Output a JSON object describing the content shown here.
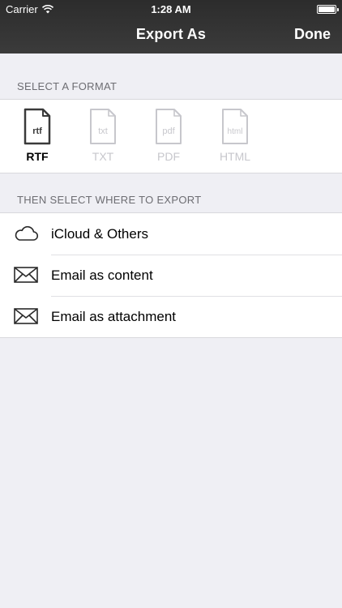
{
  "status_bar": {
    "carrier": "Carrier",
    "time": "1:28 AM"
  },
  "nav": {
    "title": "Export As",
    "done_label": "Done"
  },
  "format_section": {
    "header": "SELECT A FORMAT",
    "formats": [
      {
        "label": "RTF",
        "icon_text": "rtf",
        "selected": true
      },
      {
        "label": "TXT",
        "icon_text": "txt",
        "selected": false
      },
      {
        "label": "PDF",
        "icon_text": "pdf",
        "selected": false
      },
      {
        "label": "HTML",
        "icon_text": "html",
        "selected": false
      }
    ]
  },
  "export_section": {
    "header": "THEN SELECT WHERE TO EXPORT",
    "items": [
      {
        "label": "iCloud & Others",
        "icon": "cloud-icon"
      },
      {
        "label": "Email as content",
        "icon": "envelope-icon"
      },
      {
        "label": "Email as attachment",
        "icon": "envelope-icon"
      }
    ]
  },
  "colors": {
    "nav_background": "#333333",
    "page_background": "#efeff4",
    "selected_text": "#000000",
    "unselected_text": "#c7c7cc"
  }
}
